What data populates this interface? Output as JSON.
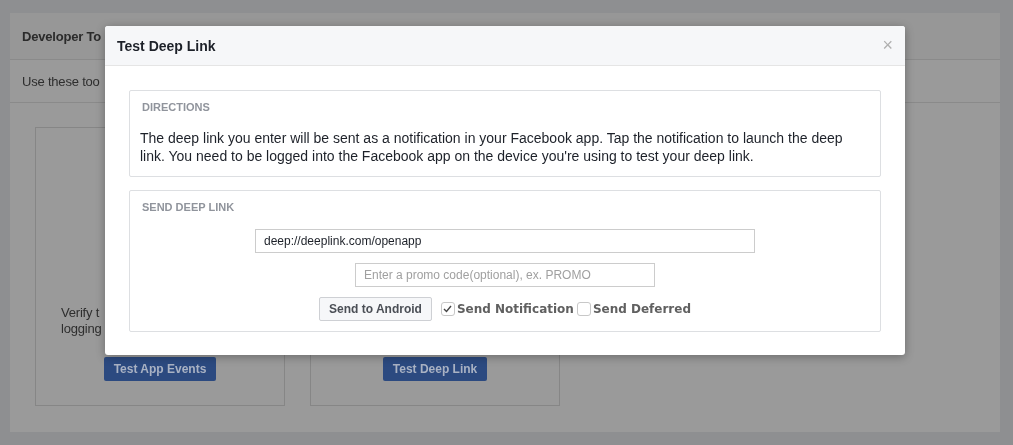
{
  "page": {
    "title": "Developer To",
    "description": "Use these too",
    "cards": [
      {
        "text_lines": [
          "Verify t",
          "logging"
        ],
        "button": "Test App Events"
      },
      {
        "button": "Test Deep Link"
      }
    ]
  },
  "dialog": {
    "title": "Test Deep Link",
    "close": "×",
    "directions": {
      "heading": "DIRECTIONS",
      "text": "The deep link you enter will be sent as a notification in your Facebook app. Tap the notification to launch the deep link. You need to be logged into the Facebook app on the device you're using to test your deep link."
    },
    "send": {
      "heading": "SEND DEEP LINK",
      "link_value": "deep://deeplink.com/openapp",
      "promo_placeholder": "Enter a promo code(optional), ex. PROMO",
      "button": "Send to Android",
      "checkboxes": [
        {
          "label": "Send Notification",
          "checked": true
        },
        {
          "label": "Send Deferred",
          "checked": false
        }
      ]
    }
  }
}
